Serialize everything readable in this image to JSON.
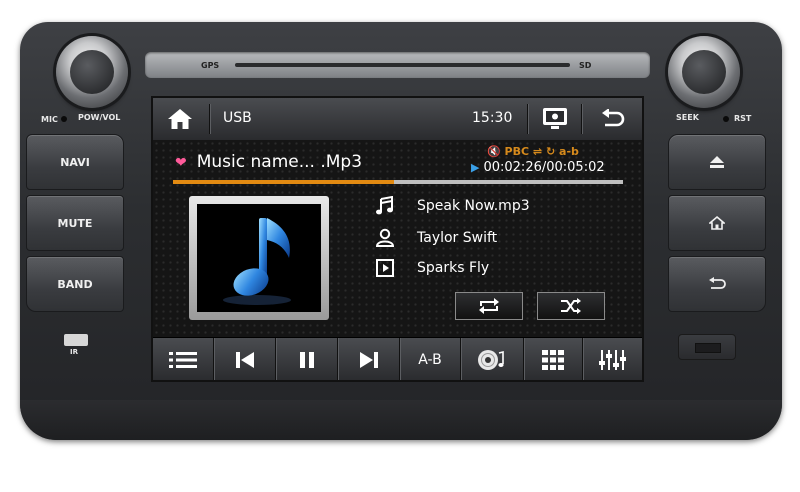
{
  "hardware": {
    "gps_label": "GPS",
    "sd_label": "SD",
    "mic_label": "MIC",
    "powvol_label": "POW/VOL",
    "seek_label": "SEEK",
    "rst_label": "RST",
    "ir_label": "IR",
    "navi_label": "NAVI",
    "mute_label": "MUTE",
    "band_label": "BAND"
  },
  "topbar": {
    "source_label": "USB",
    "clock": "15:30"
  },
  "player": {
    "title": "Music name... .Mp3",
    "elapsed_total": "00:02:26/00:05:02",
    "status_pbc": "PBC",
    "status_ab": "a-b",
    "progress_fraction": 0.49,
    "track_file": "Speak Now.mp3",
    "artist": "Taylor Swift",
    "album": "Sparks Fly"
  },
  "bottombar": {
    "ab_label": "A-B"
  },
  "colors": {
    "accent": "#e28a12",
    "play_indicator": "#3aa0e8",
    "heart": "#ff5a9a"
  },
  "icons": [
    "home-icon",
    "screen-icon",
    "back-icon",
    "heart-icon",
    "play-indicator-icon",
    "music-note-icon",
    "person-icon",
    "album-icon",
    "repeat-icon",
    "shuffle-icon",
    "list-icon",
    "prev-icon",
    "pause-icon",
    "next-icon",
    "disc-icon",
    "grid-icon",
    "equalizer-icon",
    "eject-icon",
    "home-hw-icon",
    "back-hw-icon"
  ]
}
